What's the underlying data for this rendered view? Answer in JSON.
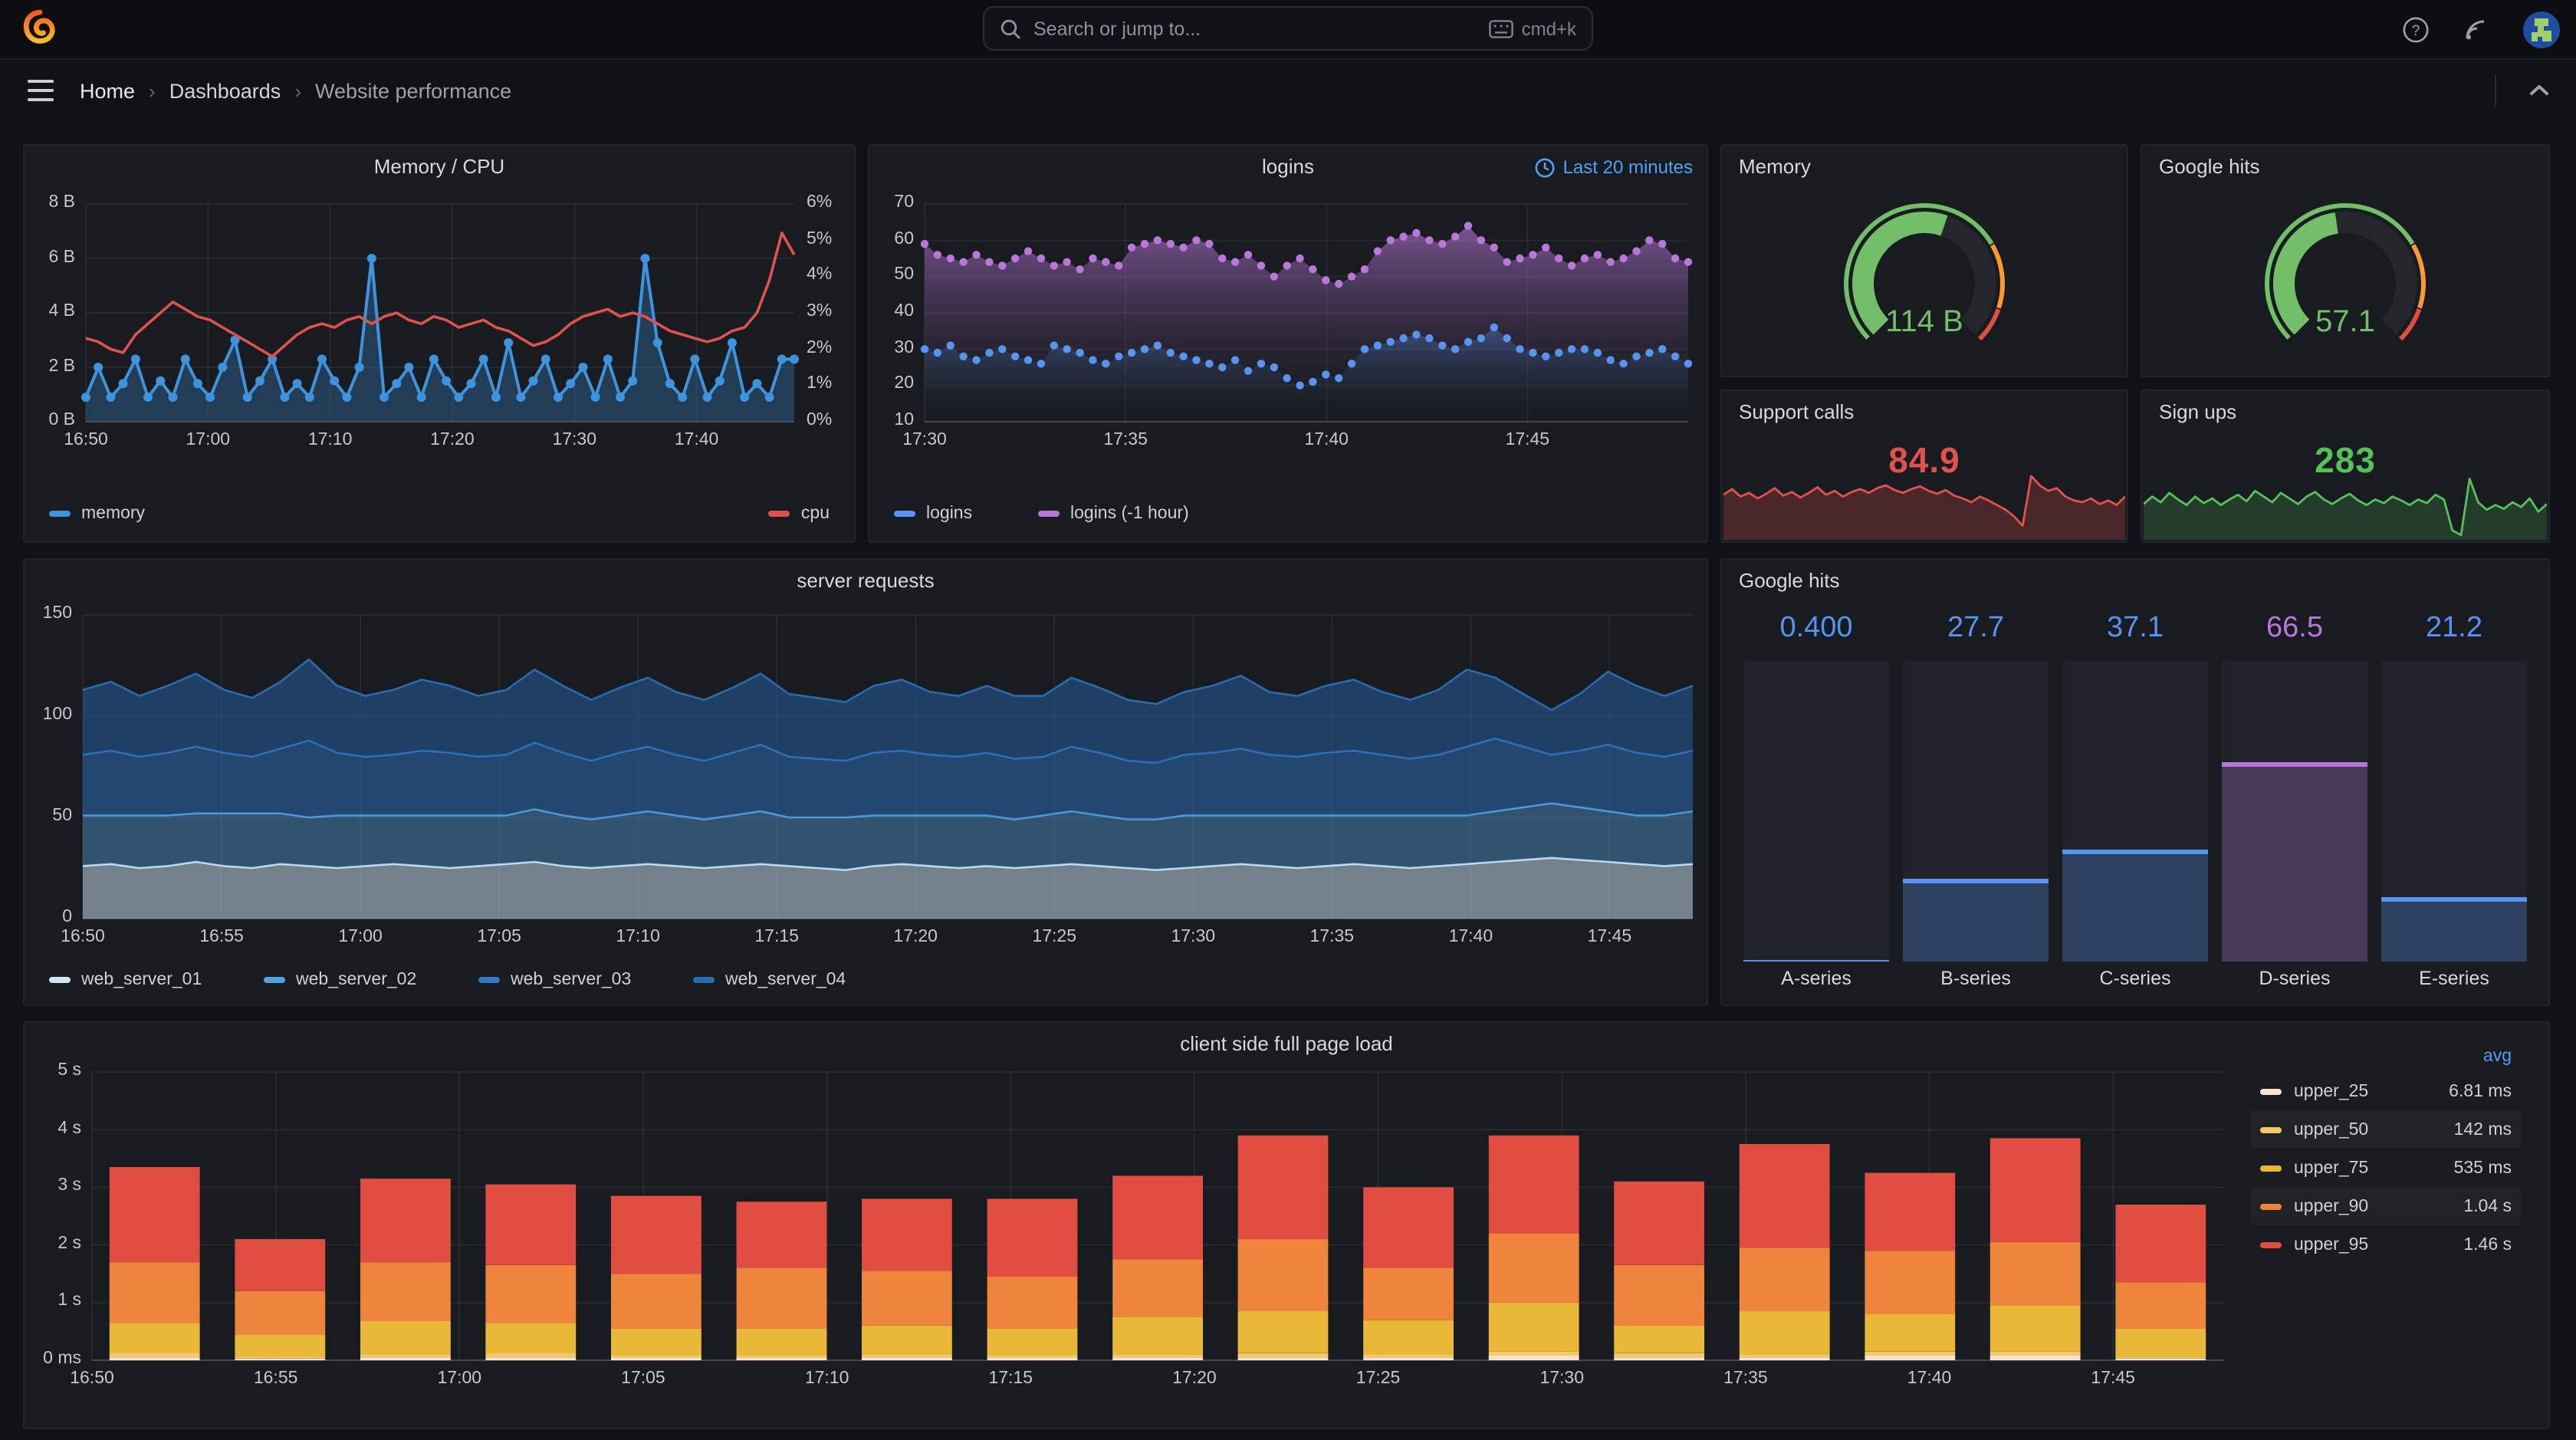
{
  "nav": {
    "search_placeholder": "Search or jump to...",
    "shortcut_label": "cmd+k",
    "breadcrumb": [
      "Home",
      "Dashboards",
      "Website performance"
    ]
  },
  "panels": {
    "memory_cpu": {
      "title": "Memory / CPU",
      "y_left_labels": [
        "8 B",
        "6 B",
        "4 B",
        "2 B",
        "0 B"
      ],
      "y_right_labels": [
        "6%",
        "5%",
        "4%",
        "3%",
        "2%",
        "1%",
        "0%"
      ],
      "x_ticks": [
        "16:50",
        "17:00",
        "17:10",
        "17:20",
        "17:30",
        "17:40"
      ],
      "x_tick_minutes": [
        0,
        10,
        20,
        30,
        40,
        50
      ],
      "range_minutes": 58,
      "legend": [
        {
          "label": "memory",
          "color": "#3d93dd"
        },
        {
          "label": "cpu",
          "color": "#e0524d"
        }
      ],
      "chart_data": {
        "type": "line",
        "y_left_range": [
          0,
          8
        ],
        "y_left_unit": "B",
        "y_right_range": [
          0,
          6
        ],
        "y_right_unit": "%",
        "series": [
          {
            "name": "memory",
            "axis": "left",
            "color": "#3d93dd",
            "values": [
              0.9,
              2.0,
              0.9,
              1.4,
              2.3,
              0.9,
              1.5,
              0.9,
              2.3,
              1.4,
              0.9,
              2.0,
              3.0,
              0.9,
              1.5,
              2.3,
              0.9,
              1.4,
              0.9,
              2.3,
              1.5,
              0.9,
              2.0,
              6.0,
              0.9,
              1.4,
              2.0,
              0.9,
              2.3,
              1.5,
              0.9,
              1.4,
              2.3,
              0.9,
              2.9,
              0.9,
              1.5,
              2.3,
              0.9,
              1.4,
              2.0,
              0.9,
              2.3,
              0.9,
              1.5,
              6.0,
              2.9,
              1.4,
              0.9,
              2.3,
              0.9,
              1.5,
              2.9,
              0.9,
              1.4,
              0.9,
              2.3,
              2.3
            ]
          },
          {
            "name": "cpu",
            "axis": "right",
            "color": "#e0524d",
            "values": [
              2.3,
              2.2,
              2.0,
              1.9,
              2.4,
              2.7,
              3.0,
              3.3,
              3.1,
              2.9,
              2.8,
              2.6,
              2.4,
              2.2,
              2.0,
              1.8,
              2.1,
              2.4,
              2.6,
              2.7,
              2.6,
              2.8,
              2.9,
              2.7,
              2.9,
              3.0,
              2.8,
              2.7,
              2.9,
              2.8,
              2.6,
              2.7,
              2.8,
              2.6,
              2.5,
              2.3,
              2.1,
              2.2,
              2.4,
              2.7,
              2.9,
              3.0,
              3.1,
              2.9,
              3.0,
              2.9,
              2.7,
              2.5,
              2.4,
              2.3,
              2.2,
              2.3,
              2.5,
              2.6,
              3.0,
              3.9,
              5.2,
              4.6
            ]
          }
        ]
      }
    },
    "logins": {
      "title": "logins",
      "time_range_label": "Last 20 minutes",
      "y_labels": [
        "70",
        "60",
        "50",
        "40",
        "30",
        "20",
        "10"
      ],
      "x_ticks": [
        "17:30",
        "17:35",
        "17:40",
        "17:45"
      ],
      "x_tick_minutes": [
        0,
        5,
        10,
        15
      ],
      "range_minutes": 19,
      "legend": [
        {
          "label": "logins",
          "color": "#5794f2"
        },
        {
          "label": "logins (-1 hour)",
          "color": "#b877d9"
        }
      ],
      "chart_data": {
        "type": "area",
        "y_range": [
          10,
          70
        ],
        "series": [
          {
            "name": "logins (-1 hour)",
            "color": "#b877d9",
            "values": [
              59,
              56,
              55,
              54,
              56,
              54,
              53,
              55,
              57,
              55,
              53,
              54,
              52,
              55,
              54,
              53,
              58,
              59,
              60,
              59,
              58,
              60,
              59,
              55,
              54,
              56,
              53,
              50,
              53,
              55,
              52,
              49,
              48,
              50,
              52,
              57,
              60,
              61,
              62,
              60,
              59,
              61,
              64,
              60,
              58,
              54,
              55,
              56,
              58,
              55,
              53,
              55,
              56,
              54,
              55,
              57,
              60,
              59,
              55,
              54
            ]
          },
          {
            "name": "logins",
            "color": "#5794f2",
            "values": [
              30,
              29,
              31,
              28,
              27,
              29,
              30,
              28,
              27,
              26,
              31,
              30,
              29,
              27,
              26,
              28,
              29,
              30,
              31,
              29,
              28,
              27,
              26,
              25,
              27,
              24,
              26,
              25,
              22,
              20,
              21,
              23,
              22,
              26,
              30,
              31,
              32,
              33,
              34,
              33,
              31,
              30,
              32,
              33,
              36,
              33,
              30,
              29,
              28,
              29,
              30,
              30,
              29,
              27,
              26,
              28,
              29,
              30,
              28,
              26
            ]
          }
        ]
      }
    },
    "memory_gauge": {
      "title": "Memory",
      "value": "114 B",
      "fraction": 0.57,
      "color": "#73bf69",
      "thresholds": [
        {
          "to": 0.72,
          "color": "#73bf69"
        },
        {
          "to": 0.9,
          "color": "#ff9830"
        },
        {
          "to": 1,
          "color": "#e24d42"
        }
      ]
    },
    "google_gauge": {
      "title": "Google hits",
      "value": "57.1",
      "fraction": 0.47,
      "color": "#73bf69",
      "thresholds": [
        {
          "to": 0.72,
          "color": "#73bf69"
        },
        {
          "to": 0.9,
          "color": "#ff9830"
        },
        {
          "to": 1,
          "color": "#e24d42"
        }
      ]
    },
    "support_calls": {
      "title": "Support calls",
      "value": "84.9",
      "color": "#e0524d",
      "chart_data": {
        "type": "sparkline",
        "values": [
          68,
          74,
          66,
          70,
          64,
          69,
          75,
          67,
          71,
          65,
          70,
          76,
          68,
          72,
          66,
          71,
          74,
          70,
          75,
          78,
          73,
          70,
          74,
          77,
          72,
          69,
          73,
          67,
          64,
          60,
          66,
          62,
          57,
          52,
          45,
          35,
          88,
          78,
          72,
          75,
          66,
          62,
          60,
          64,
          58,
          62,
          57,
          66
        ]
      }
    },
    "sign_ups": {
      "title": "Sign ups",
      "value": "283",
      "color": "#56c15a",
      "chart_data": {
        "type": "sparkline",
        "values": [
          58,
          66,
          60,
          70,
          63,
          57,
          66,
          59,
          64,
          57,
          63,
          68,
          61,
          72,
          66,
          60,
          70,
          64,
          58,
          66,
          71,
          63,
          58,
          64,
          69,
          62,
          57,
          63,
          59,
          66,
          62,
          57,
          63,
          59,
          68,
          63,
          30,
          25,
          85,
          60,
          52,
          57,
          53,
          60,
          55,
          64,
          50,
          58
        ]
      }
    },
    "server_requests": {
      "title": "server requests",
      "y_labels": [
        "150",
        "100",
        "50",
        "0"
      ],
      "x_ticks": [
        "16:50",
        "16:55",
        "17:00",
        "17:05",
        "17:10",
        "17:15",
        "17:20",
        "17:25",
        "17:30",
        "17:35",
        "17:40",
        "17:45"
      ],
      "x_tick_minutes": [
        0,
        5,
        10,
        15,
        20,
        25,
        30,
        35,
        40,
        45,
        50,
        55
      ],
      "range_minutes": 58,
      "legend": [
        {
          "label": "web_server_01",
          "color": "#cfe6f5"
        },
        {
          "label": "web_server_02",
          "color": "#55a1e0"
        },
        {
          "label": "web_server_03",
          "color": "#3178c9"
        },
        {
          "label": "web_server_04",
          "color": "#2a6bb0"
        }
      ],
      "chart_data": {
        "type": "area",
        "stacked": true,
        "y_range": [
          0,
          150
        ],
        "series": [
          {
            "name": "web_server_01",
            "color": "#cfe6f5",
            "values": [
              26,
              27,
              25,
              26,
              28,
              26,
              25,
              27,
              26,
              25,
              26,
              27,
              26,
              25,
              26,
              27,
              28,
              26,
              25,
              26,
              27,
              26,
              25,
              26,
              27,
              26,
              25,
              24,
              26,
              27,
              26,
              25,
              26,
              25,
              26,
              27,
              26,
              25,
              24,
              25,
              26,
              27,
              26,
              25,
              26,
              27,
              26,
              25,
              26,
              27,
              28,
              29,
              30,
              29,
              28,
              27,
              26,
              27
            ]
          },
          {
            "name": "web_server_02",
            "color": "#55a1e0",
            "values": [
              25,
              24,
              26,
              25,
              24,
              26,
              27,
              25,
              24,
              26,
              25,
              24,
              25,
              26,
              25,
              24,
              26,
              25,
              24,
              25,
              26,
              25,
              24,
              25,
              26,
              24,
              25,
              26,
              25,
              24,
              25,
              26,
              25,
              24,
              25,
              26,
              25,
              24,
              25,
              26,
              25,
              24,
              25,
              26,
              25,
              24,
              25,
              26,
              25,
              24,
              25,
              26,
              27,
              26,
              25,
              24,
              25,
              26
            ]
          },
          {
            "name": "web_server_03",
            "color": "#3178c9",
            "values": [
              30,
              32,
              29,
              31,
              33,
              30,
              28,
              32,
              38,
              31,
              29,
              30,
              32,
              31,
              29,
              30,
              33,
              31,
              29,
              31,
              32,
              30,
              29,
              31,
              33,
              30,
              29,
              28,
              31,
              32,
              30,
              29,
              31,
              30,
              29,
              32,
              31,
              29,
              28,
              30,
              31,
              33,
              30,
              29,
              31,
              32,
              30,
              28,
              30,
              34,
              36,
              30,
              24,
              28,
              33,
              31,
              29,
              30
            ]
          },
          {
            "name": "web_server_04",
            "color": "#2a6bb0",
            "values": [
              32,
              34,
              30,
              33,
              36,
              31,
              29,
              33,
              40,
              33,
              30,
              32,
              35,
              33,
              30,
              32,
              36,
              33,
              30,
              32,
              34,
              31,
              30,
              32,
              35,
              31,
              30,
              29,
              33,
              35,
              31,
              30,
              33,
              31,
              30,
              34,
              32,
              30,
              29,
              31,
              33,
              36,
              31,
              30,
              33,
              35,
              31,
              29,
              32,
              38,
              30,
              26,
              22,
              28,
              36,
              33,
              30,
              32
            ]
          }
        ]
      }
    },
    "google_hits_bars": {
      "title": "Google hits",
      "max": 100,
      "columns": [
        {
          "label": "A-series",
          "value": "0.400",
          "num": 0.4,
          "color": "#5794f2"
        },
        {
          "label": "B-series",
          "value": "27.7",
          "num": 27.7,
          "color": "#5794f2"
        },
        {
          "label": "C-series",
          "value": "37.1",
          "num": 37.1,
          "color": "#5794f2"
        },
        {
          "label": "D-series",
          "value": "66.5",
          "num": 66.5,
          "color": "#b877d9"
        },
        {
          "label": "E-series",
          "value": "21.2",
          "num": 21.2,
          "color": "#5794f2"
        }
      ]
    },
    "client_load": {
      "title": "client side full page load",
      "y_labels": [
        "5 s",
        "4 s",
        "3 s",
        "2 s",
        "1 s",
        "0 ms"
      ],
      "x_ticks": [
        "16:50",
        "16:55",
        "17:00",
        "17:05",
        "17:10",
        "17:15",
        "17:20",
        "17:25",
        "17:30",
        "17:35",
        "17:40",
        "17:45"
      ],
      "x_tick_minutes": [
        0,
        5,
        10,
        15,
        20,
        25,
        30,
        35,
        40,
        45,
        50,
        55
      ],
      "range_minutes": 58,
      "legend_header": "avg",
      "legend": [
        {
          "label": "upper_25",
          "value": "6.81 ms",
          "color": "#f9e2d2"
        },
        {
          "label": "upper_50",
          "value": "142 ms",
          "color": "#f2c96d"
        },
        {
          "label": "upper_75",
          "value": "535 ms",
          "color": "#eab839"
        },
        {
          "label": "upper_90",
          "value": "1.04 s",
          "color": "#ef843c"
        },
        {
          "label": "upper_95",
          "value": "1.46 s",
          "color": "#e24d42"
        }
      ],
      "chart_data": {
        "type": "stacked-bar",
        "y_range_seconds": [
          0,
          5
        ],
        "series_names": [
          "upper_25",
          "upper_50",
          "upper_75",
          "upper_90",
          "upper_95"
        ],
        "colors": [
          "#f9e2d2",
          "#f2c96d",
          "#eab839",
          "#ef843c",
          "#e24d42"
        ],
        "bars_cumulative_seconds": [
          [
            0.05,
            0.12,
            0.65,
            1.7,
            3.35
          ],
          [
            0.03,
            0.06,
            0.45,
            1.2,
            2.1
          ],
          [
            0.05,
            0.1,
            0.68,
            1.7,
            3.15
          ],
          [
            0.05,
            0.12,
            0.65,
            1.65,
            3.05
          ],
          [
            0.04,
            0.08,
            0.55,
            1.5,
            2.85
          ],
          [
            0.04,
            0.08,
            0.55,
            1.6,
            2.75
          ],
          [
            0.05,
            0.1,
            0.6,
            1.55,
            2.8
          ],
          [
            0.04,
            0.08,
            0.55,
            1.45,
            2.8
          ],
          [
            0.05,
            0.1,
            0.75,
            1.75,
            3.2
          ],
          [
            0.05,
            0.12,
            0.85,
            2.1,
            3.9
          ],
          [
            0.05,
            0.1,
            0.7,
            1.6,
            3.0
          ],
          [
            0.08,
            0.15,
            1.0,
            2.2,
            3.9
          ],
          [
            0.05,
            0.12,
            0.6,
            1.65,
            3.1
          ],
          [
            0.05,
            0.1,
            0.85,
            1.95,
            3.75
          ],
          [
            0.08,
            0.15,
            0.8,
            1.9,
            3.25
          ],
          [
            0.08,
            0.15,
            0.95,
            2.05,
            3.85
          ],
          [
            0.03,
            0.06,
            0.55,
            1.35,
            2.7
          ]
        ]
      }
    }
  }
}
